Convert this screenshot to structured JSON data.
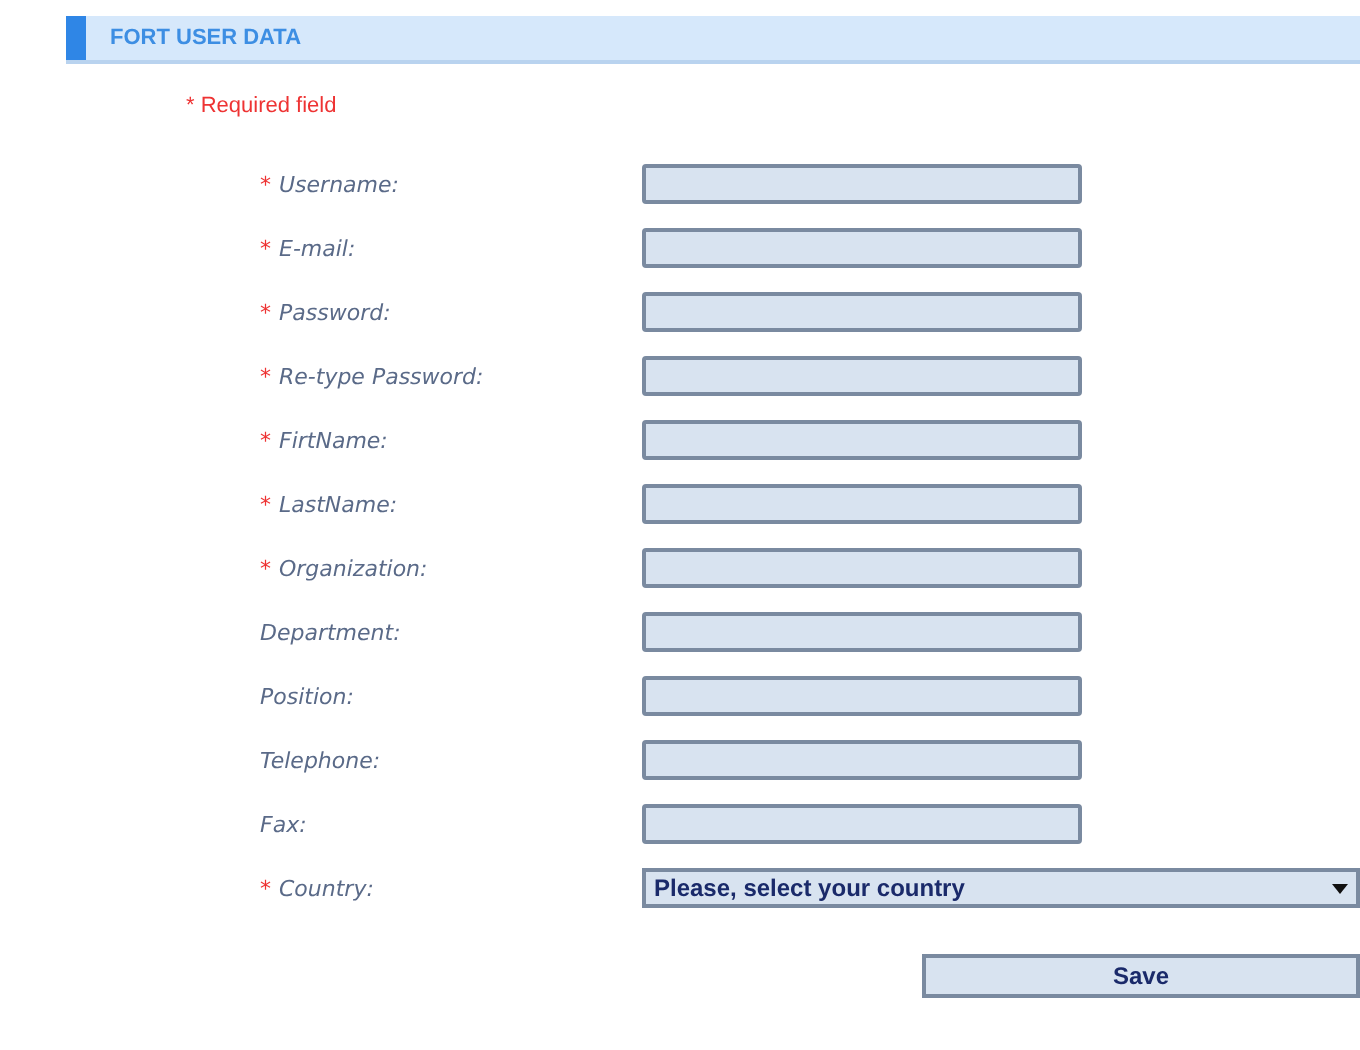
{
  "header": {
    "title": "FORT USER DATA"
  },
  "required_note": "* Required field",
  "fields": [
    {
      "mark": "*",
      "label": "Username:",
      "kind": "text"
    },
    {
      "mark": "*",
      "label": "E-mail:",
      "kind": "text"
    },
    {
      "mark": "*",
      "label": "Password:",
      "kind": "text"
    },
    {
      "mark": "*",
      "label": "Re-type Password:",
      "kind": "text"
    },
    {
      "mark": "*",
      "label": "FirtName:",
      "kind": "text"
    },
    {
      "mark": "*",
      "label": "LastName:",
      "kind": "text"
    },
    {
      "mark": "*",
      "label": "Organization:",
      "kind": "text"
    },
    {
      "label": "Department:",
      "kind": "text"
    },
    {
      "label": "Position:",
      "kind": "text"
    },
    {
      "label": "Telephone:",
      "kind": "text"
    },
    {
      "label": "Fax:",
      "kind": "text"
    },
    {
      "mark": "*",
      "label": "Country:",
      "kind": "select",
      "value": "Please, select your country"
    }
  ],
  "save_button": "Save"
}
